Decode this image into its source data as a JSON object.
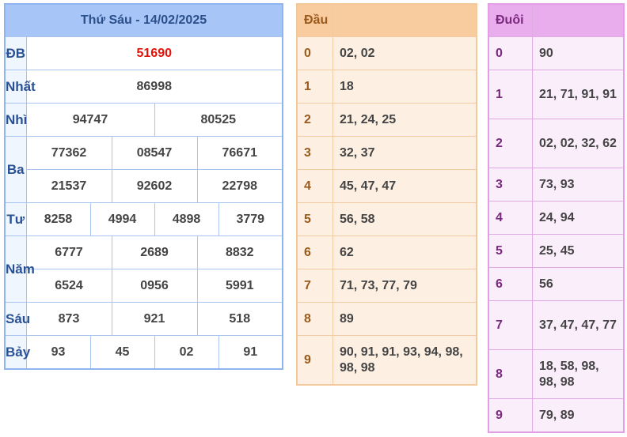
{
  "result": {
    "title": "Thứ Sáu - 14/02/2025",
    "rows": [
      {
        "label": "ĐB",
        "values": [
          "51690"
        ]
      },
      {
        "label": "Nhất",
        "values": [
          "86998"
        ]
      },
      {
        "label": "Nhì",
        "values": [
          "94747",
          "80525"
        ]
      },
      {
        "label": "Ba",
        "values": [
          "77362",
          "08547",
          "76671",
          "21537",
          "92602",
          "22798"
        ]
      },
      {
        "label": "Tư",
        "values": [
          "8258",
          "4994",
          "4898",
          "3779"
        ]
      },
      {
        "label": "Năm",
        "values": [
          "6777",
          "2689",
          "8832",
          "6524",
          "0956",
          "5991"
        ]
      },
      {
        "label": "Sáu",
        "values": [
          "873",
          "921",
          "518"
        ]
      },
      {
        "label": "Bảy",
        "values": [
          "93",
          "45",
          "02",
          "91"
        ]
      }
    ]
  },
  "dau": {
    "header": "Đầu",
    "rows": [
      {
        "key": "0",
        "value": "02, 02"
      },
      {
        "key": "1",
        "value": "18"
      },
      {
        "key": "2",
        "value": "21, 24, 25"
      },
      {
        "key": "3",
        "value": "32, 37"
      },
      {
        "key": "4",
        "value": "45, 47, 47"
      },
      {
        "key": "5",
        "value": "56, 58"
      },
      {
        "key": "6",
        "value": "62"
      },
      {
        "key": "7",
        "value": "71, 73, 77, 79"
      },
      {
        "key": "8",
        "value": "89"
      },
      {
        "key": "9",
        "value": "90, 91, 91, 93, 94, 98, 98, 98"
      }
    ]
  },
  "duoi": {
    "header": "Đuôi",
    "rows": [
      {
        "key": "0",
        "value": "90"
      },
      {
        "key": "1",
        "value": "21, 71, 91, 91"
      },
      {
        "key": "2",
        "value": "02, 02, 32, 62"
      },
      {
        "key": "3",
        "value": "73, 93"
      },
      {
        "key": "4",
        "value": "24, 94"
      },
      {
        "key": "5",
        "value": "25, 45"
      },
      {
        "key": "6",
        "value": "56"
      },
      {
        "key": "7",
        "value": "37, 47, 47, 77"
      },
      {
        "key": "8",
        "value": "18, 58, 98, 98, 98"
      },
      {
        "key": "9",
        "value": "79, 89"
      }
    ]
  },
  "colors": {
    "special_prize": "#e0140a",
    "result_header": "#a7c5f7",
    "dau_header": "#f9cca0",
    "duoi_header": "#e9acec"
  }
}
